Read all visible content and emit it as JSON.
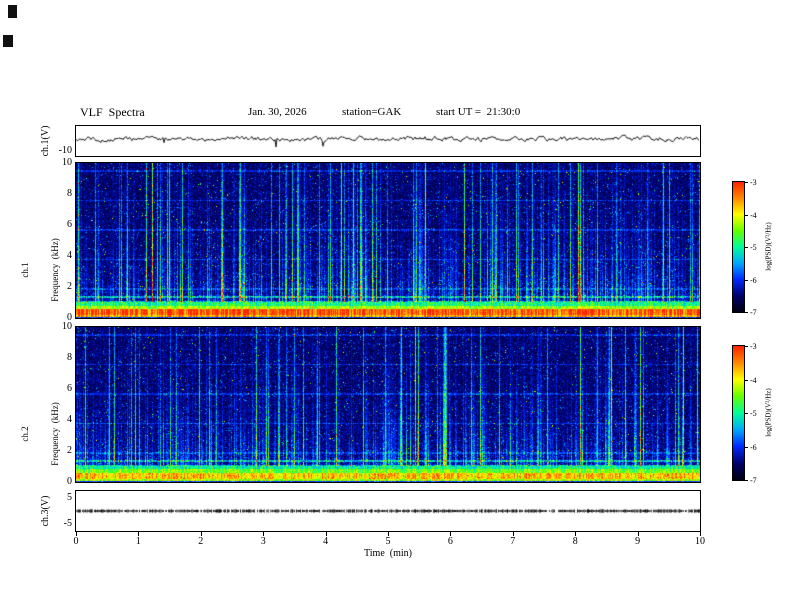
{
  "header": {
    "title": "VLF  Spectra",
    "date": "Jan. 30, 2026",
    "station": "station=GAK",
    "start_ut": "start UT =  21:30:0"
  },
  "panels": {
    "ch1_wave": {
      "ylabel": "ch.1(V)",
      "ytick_bottom": "-10"
    },
    "ch1_spec": {
      "ylabel_line1": "ch.1",
      "ylabel_line2": "Frequency  (kHz)",
      "yticks": [
        "10",
        "8",
        "6",
        "4",
        "2",
        "0"
      ]
    },
    "ch2_spec": {
      "ylabel_line1": "ch.2",
      "ylabel_line2": "Frequency  (kHz)",
      "yticks": [
        "10",
        "8",
        "6",
        "4",
        "2",
        "0"
      ]
    },
    "ch3_wave": {
      "ylabel": "ch.3(V)",
      "yticks": [
        "5",
        "-5"
      ]
    }
  },
  "xaxis": {
    "label": "Time  (min)",
    "ticks": [
      "0",
      "1",
      "2",
      "3",
      "4",
      "5",
      "6",
      "7",
      "8",
      "9",
      "10"
    ]
  },
  "colorbar": {
    "label": "log(PSD)(V²/Hz)",
    "ticks": [
      "-3",
      "-4",
      "-5",
      "-6",
      "-7"
    ],
    "range": [
      -7,
      -3
    ],
    "colormap": [
      "#000010",
      "#00006e",
      "#0028ff",
      "#00a8ff",
      "#00ff99",
      "#66ff00",
      "#ffff00",
      "#ff8800",
      "#ff2200"
    ]
  },
  "chart_data": [
    {
      "type": "line",
      "name": "ch1-waveform",
      "ylabel": "ch.1(V)",
      "xlim": [
        0,
        10
      ],
      "ylim": [
        -10,
        10
      ],
      "yticks": [
        -10
      ],
      "summary": "continuous noisy black trace fluctuating around 0 V with irregular ~±2 V excursions across the full 10 minutes"
    },
    {
      "type": "heatmap",
      "name": "ch1-spectrogram",
      "ylabel": "ch.1 Frequency (kHz)",
      "xlabel": "Time (min)",
      "xlim": [
        0,
        10
      ],
      "ylim": [
        0,
        10
      ],
      "yticks": [
        0,
        2,
        4,
        6,
        8,
        10
      ],
      "zlabel": "log(PSD)(V²/Hz)",
      "zlim": [
        -7,
        -3
      ],
      "features": [
        "dark blue/black broadband noise background",
        "dense vertical impulsive sferic streaks (blue, cyan, green, yellow), many spanning 0-10 kHz",
        "intense continuous horizontal band below ~1 kHz peaking red/orange near 0.3-0.6 kHz with yellow/green edges",
        "cyan hum line near 1-1.5 kHz and faint horizontal harmonic lines at higher frequencies"
      ]
    },
    {
      "type": "heatmap",
      "name": "ch2-spectrogram",
      "ylabel": "ch.2 Frequency (kHz)",
      "xlabel": "Time (min)",
      "xlim": [
        0,
        10
      ],
      "ylim": [
        0,
        10
      ],
      "yticks": [
        0,
        2,
        4,
        6,
        8,
        10
      ],
      "zlabel": "log(PSD)(V²/Hz)",
      "zlim": [
        -7,
        -3
      ],
      "features": [
        "dark blue/black broadband noise background",
        "dense vertical sferic streaks similar to ch.1",
        "continuous yellow-green band below ~1 kHz, slightly weaker than ch.1, with sparse red speckles",
        "cyan hum lines near 1-1.5 kHz"
      ]
    },
    {
      "type": "line",
      "name": "ch3-waveform",
      "ylabel": "ch.3(V)",
      "xlim": [
        0,
        10
      ],
      "ylim": [
        -5,
        5
      ],
      "yticks": [
        5,
        -5
      ],
      "summary": "flat dense dark dotted trace sitting at 0 V for the entire interval"
    }
  ]
}
